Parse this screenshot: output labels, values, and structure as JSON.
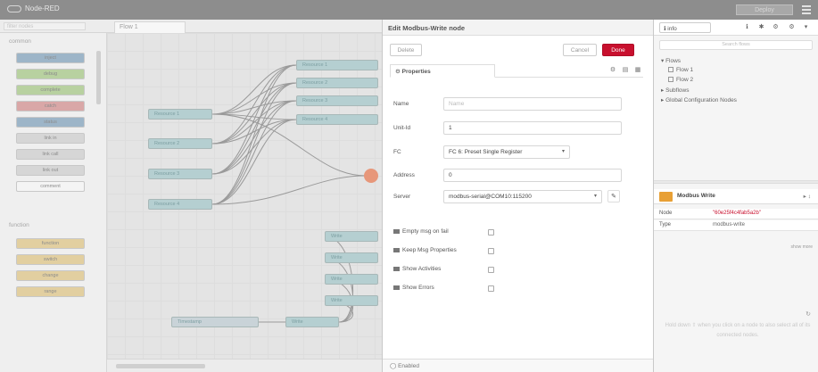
{
  "header": {
    "app_name": "Node-RED",
    "deploy_label": "Deploy"
  },
  "workspace": {
    "filter_placeholder": "filter nodes",
    "tab_label": "Flow 1",
    "palette_categories": [
      "common",
      "function"
    ],
    "palette_nodes_common": [
      "inject",
      "debug",
      "complete",
      "catch",
      "status",
      "link in",
      "link call",
      "link out",
      "comment"
    ],
    "palette_nodes_function": [
      "function",
      "switch",
      "change",
      "range"
    ],
    "flow_nodes_left": [
      "Resource 1",
      "Resource 2",
      "Resource 3",
      "Resource 4"
    ],
    "flow_nodes_right": [
      "Resource 1",
      "Resource 2",
      "Resource 3",
      "Resource 4"
    ],
    "flow_nodes_bottom": [
      "Write",
      "Write",
      "Write",
      "Write"
    ],
    "flow_node_inject": "Timestamp",
    "flow_node_mid": "Write"
  },
  "dialog": {
    "title": "Edit Modbus-Write node",
    "delete_label": "Delete",
    "cancel_label": "Cancel",
    "done_label": "Done",
    "tab_properties": "Properties",
    "fields": {
      "name_label": "Name",
      "name_placeholder": "Name",
      "unit_id_label": "Unit-Id",
      "unit_id_value": "1",
      "fc_label": "FC",
      "fc_value": "FC 6: Preset Single Register",
      "address_label": "Address",
      "address_value": "0",
      "server_label": "Server",
      "server_value": "modbus-serial@COM10:115200"
    },
    "checkboxes": [
      "Empty msg on fail",
      "Keep Msg Properties",
      "Show Activities",
      "Show Errors"
    ],
    "footer_label": "Enabled"
  },
  "sidebar": {
    "tab_label": "info",
    "search_placeholder": "Search flows",
    "tree": {
      "flows_label": "Flows",
      "flow1": "Flow 1",
      "flow2": "Flow 2",
      "subflows_label": "Subflows",
      "global_label": "Global Configuration Nodes"
    },
    "node_info": {
      "title": "Modbus Write",
      "node_key": "Node",
      "node_value": "\"60e25f4c4fab5a2b\"",
      "type_key": "Type",
      "type_value": "modbus-write",
      "show_more": "show more"
    },
    "help_text": "Hold down ⇧ when you click on a node to also select all of its connected nodes."
  },
  "colors": {
    "done_red": "#c8102e",
    "node_teal": "#b5cfd1",
    "sidebar_node_orange": "#e8a035"
  }
}
